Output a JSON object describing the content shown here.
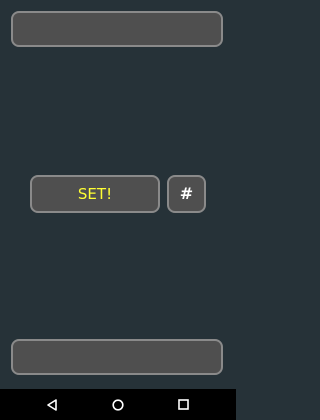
{
  "displays": {
    "top_value": "",
    "bottom_value": ""
  },
  "controls": {
    "set_label": "SET!",
    "hash_label": "#"
  },
  "navbar": {
    "back_icon": "back-triangle-icon",
    "home_icon": "home-circle-icon",
    "recents_icon": "recents-square-icon"
  },
  "colors": {
    "background": "#263238",
    "control_fill": "#4f4f4f",
    "control_border": "#8a8a8a",
    "set_text": "#ffff33",
    "hash_text": "#ffffff",
    "navbar": "#000000"
  }
}
